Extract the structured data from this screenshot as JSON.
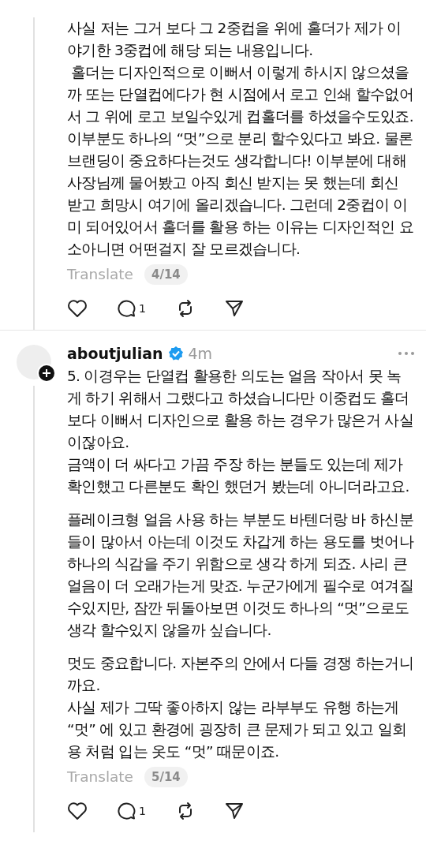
{
  "posts": [
    {
      "paragraphs": [
        "사실 저는 그거 보다 그 2중컵을 위에 홀더가 제가 이야기한 3중컵에 해당 되는 내용입니다.\n 홀더는 디자인적으로 이뻐서 이렇게 하시지 않으셨을까 또는 단열컵에다가 현 시점에서 로고 인쇄 할수없어서 그 위에 로고 보일수있게 컵홀더를 하셨을수도있죠. 이부분도 하나의 “멋”으로 분리 할수있다고 봐요. 물론 브랜딩이 중요하다는것도 생각합니다! 이부분에 대해 사장님께 물어봤고 아직 회신 받지는 못 했는데 회신 받고 희망시 여기에 올리겠습니다. 그런데 2중컵이 이미 되어있어서 홀더를 활용 하는 이유는 디자인적인 요소아니면 어떤걸지 잘 모르겠습니다."
      ],
      "translate": "Translate",
      "counter": "4/14",
      "reply_count": "1"
    },
    {
      "author": {
        "username": "aboutjulian",
        "verified": true,
        "time": "4m"
      },
      "paragraphs": [
        "5. 이경우는 단열컵 활용한 의도는 얼음 작아서 못 녹게 하기 위해서 그랬다고 하셨습니다만 이중컵도 홀더보다 이뻐서 디자인으로 활용 하는 경우가 많은거 사실이잖아요.\n금액이 더 싸다고 가끔 주장 하는 분들도 있는데 제가 확인했고 다른분도 확인 했던거 봤는데 아니더라고요.",
        "플레이크형 얼음 사용 하는 부분도 바텐더랑 바 하신분들이 많아서 아는데 이것도 차갑게 하는 용도를 벗어나 하나의 식감을 주기 위함으로 생각 하게 되죠. 사리 큰 얼음이 더 오래가는게 맞죠. 누군가에게 필수로 여겨질수있지만, 잠깐 뒤돌아보면 이것도 하나의 “멋”으로도 생각 할수있지 않을까 싶습니다.",
        "멋도 중요합니다. 자본주의 안에서 다들 경쟁 하는거니까요.\n사실 제가 그딱 좋아하지 않는 라부부도 유행 하는게 “멋” 에 있고 환경에 굉장히 큰 문제가 되고 있고 일회용 처럼 입는 옷도 “멋” 때문이죠."
      ],
      "translate": "Translate",
      "counter": "5/14",
      "reply_count": "1"
    }
  ]
}
